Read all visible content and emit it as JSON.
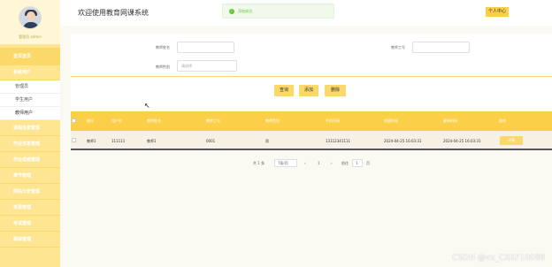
{
  "topbar": {
    "app_title": "欢迎使用教育网课系统",
    "toast": "添加成功",
    "profile": "个人中心"
  },
  "sidebar": {
    "user_name": "管理员 admin",
    "home": "首页首页",
    "group_user": "系统用户",
    "subitems": [
      "管理员",
      "学生用户",
      "教师用户"
    ],
    "items": [
      "课程信息管理",
      "作业信息管理",
      "作业成绩管理",
      "章节管理",
      "网站公告管理",
      "资源管理",
      "考试管理",
      "题库管理"
    ]
  },
  "search": {
    "name_label": "教师姓名",
    "number_label": "教师工号",
    "gender_label": "教师性别",
    "gender_placeholder": "请选择"
  },
  "buttons": {
    "query": "查询",
    "add": "添加",
    "delete": "删除"
  },
  "table": {
    "headers": [
      "编号",
      "用户名",
      "教师姓名",
      "教师工号",
      "教师性别",
      "手机号码",
      "创建时间",
      "更新时间",
      "操作"
    ],
    "rows": [
      [
        "教师1",
        "111111",
        "教师1",
        "0001",
        "男",
        "13112341111",
        "2024-04-25 16:03:31",
        "2024-04-25 16:03:31"
      ]
    ],
    "edit_label": "详情"
  },
  "pagination": {
    "total": "共 1 条",
    "page_size": "7条/页",
    "prev": "‹",
    "current": "1",
    "next": "›",
    "goto": "前往",
    "page_input": "1",
    "page_suffix": "页"
  },
  "watermark": "CSDN @vx_CXKF10088"
}
